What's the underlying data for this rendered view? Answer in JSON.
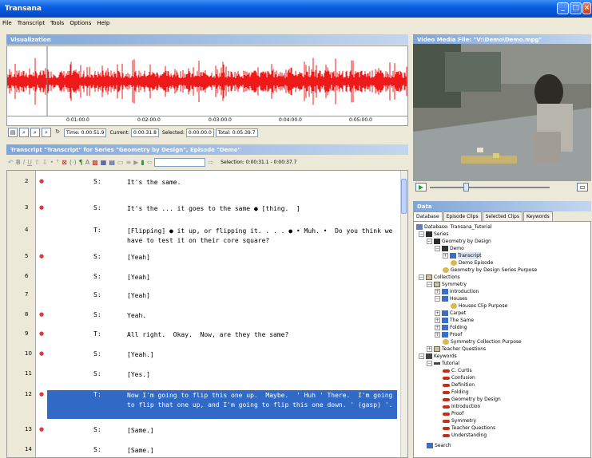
{
  "window": {
    "title": "Transana",
    "minimize_glyph": "_",
    "maximize_glyph": "□",
    "close_glyph": "×"
  },
  "menu": [
    "File",
    "Transcript",
    "Tools",
    "Options",
    "Help"
  ],
  "visualization": {
    "title": "Visualization",
    "ticks": [
      "0:01:00.0",
      "0:02:00.0",
      "0:03:00.0",
      "0:04:00.0",
      "0:05:00.0"
    ],
    "time_label": "Time: 0:00:51.9",
    "current_label": "Current:",
    "current_value": "0:00:31.8",
    "selected_label": "Selected:",
    "selected_value": "0:00:00.0",
    "total_label": "Total: 0:05:39.7",
    "waveform_color": "#ee1a1a"
  },
  "transcript": {
    "title": "Transcript \"Transcript\" for Series \"Geometry by Design\", Episode \"Demo\"",
    "selection": "Selection: 0:00:31.1 - 0:00:37.7",
    "rows": [
      {
        "num": "2",
        "spk": "S:",
        "text": "It's the same.",
        "dot": "●"
      },
      {
        "num": "3",
        "spk": "S:",
        "text": "It's the ... it goes to the same ● [thing.  ]",
        "dot": "●"
      },
      {
        "num": "4",
        "spk": "T:",
        "text": "[Flipping] ● it up, or flipping it. . . . ● • Muh. •  Do you think we have to test it on their core square?",
        "dot": ""
      },
      {
        "num": "5",
        "spk": "S:",
        "text": "[Yeah]",
        "dot": "●"
      },
      {
        "num": "6",
        "spk": "S:",
        "text": "[Yeah]",
        "dot": ""
      },
      {
        "num": "7",
        "spk": "S:",
        "text": "[Yeah]",
        "dot": ""
      },
      {
        "num": "8",
        "spk": "S:",
        "text": "Yeah.",
        "dot": "●"
      },
      {
        "num": "9",
        "spk": "T:",
        "text": "All right.  Okay.  Now, are they the same?",
        "dot": "●"
      },
      {
        "num": "10",
        "spk": "S:",
        "text": "[Yeah.]",
        "dot": "●"
      },
      {
        "num": "11",
        "spk": "S:",
        "text": "[Yes.]",
        "dot": ""
      },
      {
        "num": "12",
        "spk": "T:",
        "text": "Now I'm going to flip this one up.  Maybe.  ' Huh ' There.  I'm going to flip that one up, and I'm going to flip this one down. ' (gasp) '.",
        "dot": "●"
      },
      {
        "num": "13",
        "spk": "S:",
        "text": "[Same.]",
        "dot": "●"
      },
      {
        "num": "14",
        "spk": "S:",
        "text": "[Same.]",
        "dot": ""
      }
    ]
  },
  "video": {
    "title": "Video Media File: \"V:\\Demo\\Demo.mpg\""
  },
  "data": {
    "title": "Data",
    "tabs": [
      "Database",
      "Episode Clips",
      "Selected Clips",
      "Keywords"
    ],
    "tree": [
      {
        "label": "Database: Transana_Tutorial",
        "icon": "database-icon"
      },
      {
        "label": "Series",
        "icon": "series-icon"
      },
      {
        "label": "Geometry by Design",
        "icon": "series-icon"
      },
      {
        "label": "Demo",
        "icon": "episode-icon"
      },
      {
        "label": "Transcript",
        "icon": "transcript-icon"
      },
      {
        "label": "Demo Episode",
        "icon": "purpose-icon"
      },
      {
        "label": "Geometry by Design Series Purpose",
        "icon": "purpose-icon"
      },
      {
        "label": "Collections",
        "icon": "collection-icon"
      },
      {
        "label": "Symmetry",
        "icon": "collection-icon"
      },
      {
        "label": "Introduction",
        "icon": "clip-icon"
      },
      {
        "label": "Houses",
        "icon": "clip-icon"
      },
      {
        "label": "Houses Clip Purpose",
        "icon": "purpose-icon"
      },
      {
        "label": "Carpet",
        "icon": "clip-icon"
      },
      {
        "label": "The Same",
        "icon": "clip-icon"
      },
      {
        "label": "Folding",
        "icon": "clip-icon"
      },
      {
        "label": "Proof",
        "icon": "clip-icon"
      },
      {
        "label": "Symmetry Collection Purpose",
        "icon": "purpose-icon"
      },
      {
        "label": "Teacher Questions",
        "icon": "collection-icon"
      },
      {
        "label": "Keywords",
        "icon": "keyword-group-icon"
      },
      {
        "label": "Tutorial",
        "icon": "keyword-group-icon"
      },
      {
        "label": "C. Curtis",
        "icon": "keyword-icon"
      },
      {
        "label": "Confusion",
        "icon": "keyword-icon"
      },
      {
        "label": "Definition",
        "icon": "keyword-icon"
      },
      {
        "label": "Folding",
        "icon": "keyword-icon"
      },
      {
        "label": "Geometry by Design",
        "icon": "keyword-icon"
      },
      {
        "label": "Introduction",
        "icon": "keyword-icon"
      },
      {
        "label": "Proof",
        "icon": "keyword-icon"
      },
      {
        "label": "Symmetry",
        "icon": "keyword-icon"
      },
      {
        "label": "Teacher Questions",
        "icon": "keyword-icon"
      },
      {
        "label": "Understanding",
        "icon": "keyword-icon"
      },
      {
        "label": "Search",
        "icon": "search-icon"
      }
    ]
  }
}
